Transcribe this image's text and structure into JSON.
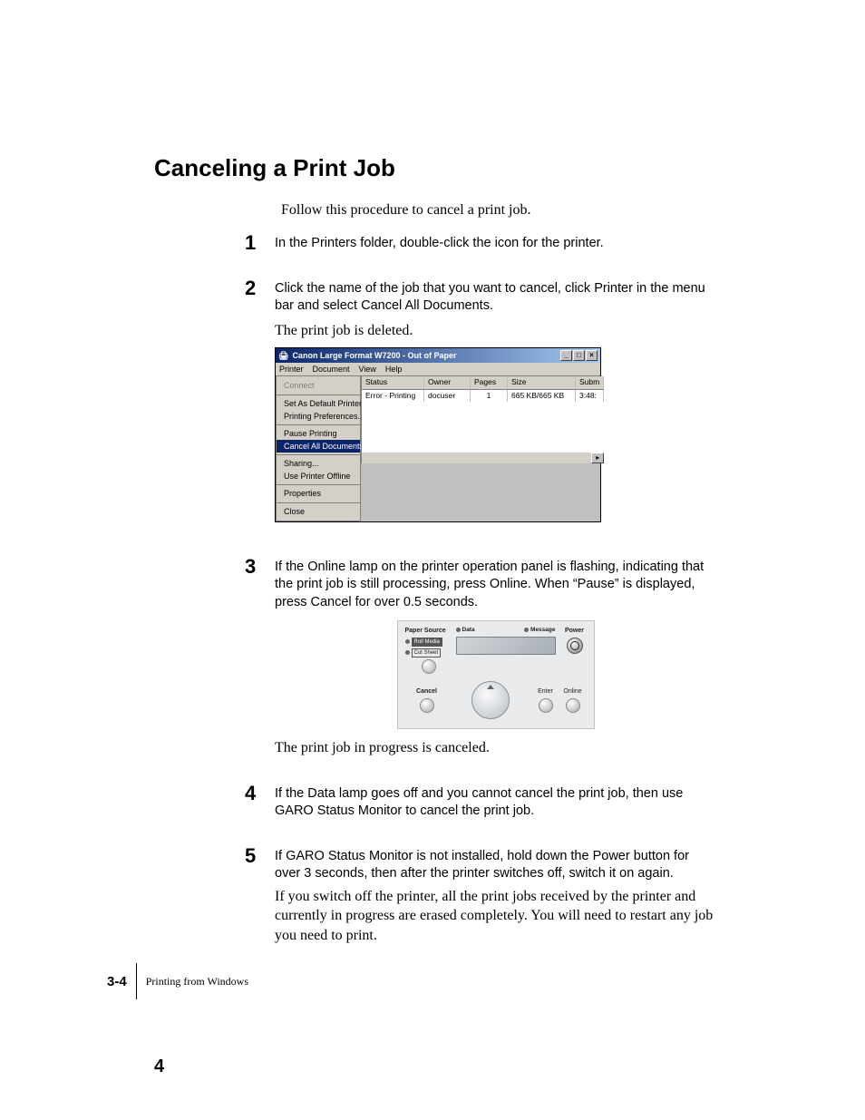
{
  "heading": "Canceling a Print Job",
  "intro": "Follow this procedure to cancel a print job.",
  "steps": {
    "s1": {
      "num": "1",
      "text": "In the Printers folder, double-click the icon for the printer."
    },
    "s2": {
      "num": "2",
      "text": "Click the name of the job that you want to cancel, click Printer in the menu bar and select Cancel All Documents.",
      "after": "The print job is deleted."
    },
    "s3": {
      "num": "3",
      "text": "If the Online lamp on the printer operation panel is flashing, indicating that the print job is still processing, press Online. When “Pause” is displayed, press Cancel for over 0.5 seconds.",
      "after": "The print job in progress is canceled."
    },
    "s4": {
      "num": "4",
      "text": "If the Data lamp goes off and you cannot cancel the print job, then use GARO Status Monitor to cancel the print job."
    },
    "s5": {
      "num": "5",
      "text": "If GARO Status Monitor is not installed, hold down the Power button for over 3 seconds, then after the printer switches off, switch it on again.",
      "after": "If you switch off the printer, all the print jobs received by the printer and currently in progress are erased completely. You will need to restart any job you need to print."
    }
  },
  "win": {
    "title": "Canon Large Format W7200 - Out of Paper",
    "menus": {
      "m1": "Printer",
      "m2": "Document",
      "m3": "View",
      "m4": "Help"
    },
    "drop": {
      "connect": "Connect",
      "setdef": "Set As Default Printer",
      "prefs": "Printing Preferences...",
      "pause": "Pause Printing",
      "cancel": "Cancel All Documents",
      "sharing": "Sharing...",
      "offline": "Use Printer Offline",
      "props": "Properties",
      "close": "Close"
    },
    "cols": {
      "status": "Status",
      "owner": "Owner",
      "pages": "Pages",
      "size": "Size",
      "subm": "Subm"
    },
    "row": {
      "status": "Error - Printing",
      "owner": "docuser",
      "pages": "1",
      "size": "665 KB/665 KB",
      "subm": "3:48:"
    }
  },
  "panel": {
    "paper_source": "Paper Source",
    "roll": "Roll Media",
    "cut": "Cut Sheet",
    "data": "Data",
    "message": "Message",
    "power": "Power",
    "cancel": "Cancel",
    "enter": "Enter",
    "online": "Online"
  },
  "footer": {
    "pagenum": "3-4",
    "chapter": "Printing from Windows",
    "corner": "4"
  }
}
